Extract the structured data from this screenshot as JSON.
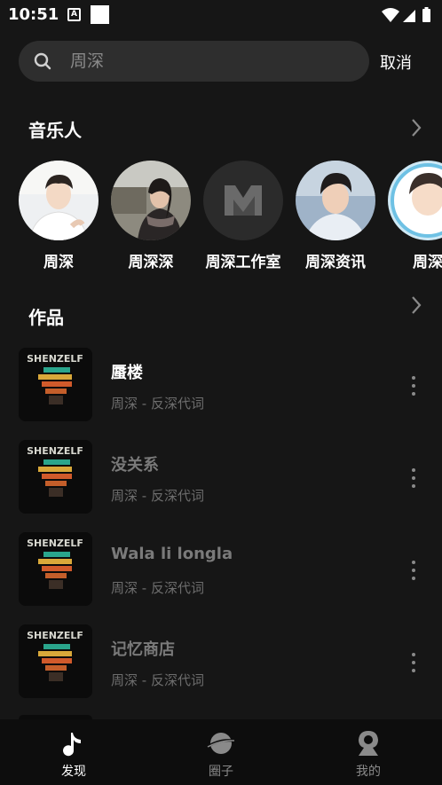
{
  "status_bar": {
    "time": "10:51",
    "notif_badge": "A"
  },
  "search": {
    "value": "周深",
    "cancel_label": "取消"
  },
  "artists_section": {
    "title": "音乐人",
    "items": [
      {
        "name": "周深"
      },
      {
        "name": "周深深"
      },
      {
        "name": "周深工作室"
      },
      {
        "name": "周深资讯"
      },
      {
        "name": "周深"
      }
    ]
  },
  "songs_section": {
    "title": "作品",
    "items": [
      {
        "title": "蜃楼",
        "subtitle": "周深 - 反深代词",
        "title_color": "#ffffff"
      },
      {
        "title": "没关系",
        "subtitle": "周深 - 反深代词",
        "title_color": "#7a7a7a"
      },
      {
        "title": "Wala li longla",
        "subtitle": "周深 - 反深代词",
        "title_color": "#7a7a7a"
      },
      {
        "title": "记忆商店",
        "subtitle": "周深 - 反深代词",
        "title_color": "#7a7a7a"
      }
    ]
  },
  "bottom_nav": {
    "items": [
      {
        "label": "发现",
        "icon": "music-note-icon",
        "active": true
      },
      {
        "label": "圈子",
        "icon": "planet-icon",
        "active": false
      },
      {
        "label": "我的",
        "icon": "profile-icon",
        "active": false
      }
    ]
  },
  "colors": {
    "background": "#161616",
    "search_bg": "#2e2e2e",
    "inactive": "#8a8a8a",
    "nav_bg": "#0d0d0d"
  }
}
